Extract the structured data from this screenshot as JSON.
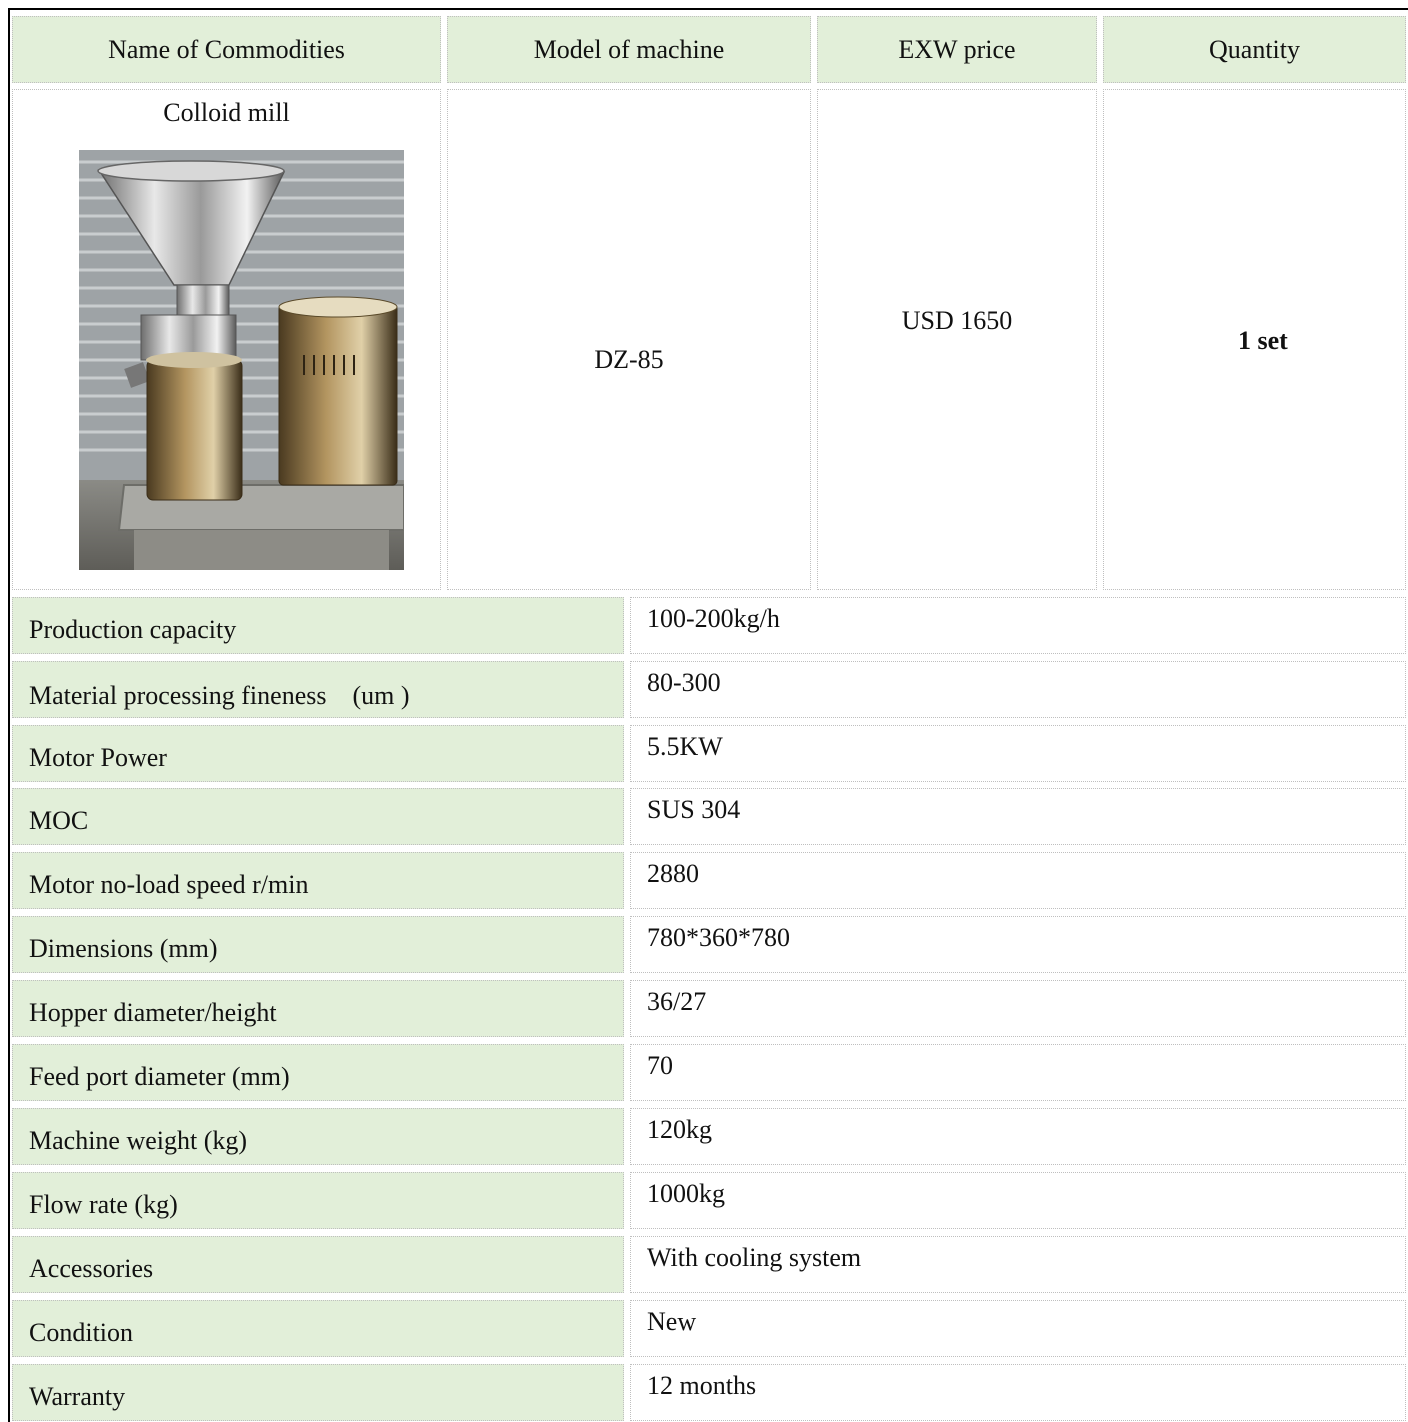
{
  "header": {
    "name_of_commodities": "Name of Commodities",
    "model_of_machine": "Model of machine",
    "exw_price": "EXW price",
    "quantity": "Quantity"
  },
  "product": {
    "name": "Colloid mill",
    "model": "DZ-85",
    "price": "USD 1650",
    "quantity": "1 set",
    "image_icon": "colloid-mill-photo"
  },
  "specs": [
    {
      "label": "Production capacity",
      "value": "100-200kg/h"
    },
    {
      "label": "Material processing fineness　(um )",
      "value": "80-300"
    },
    {
      "label": "Motor Power",
      "value": "5.5KW"
    },
    {
      "label": "MOC",
      "value": "SUS 304"
    },
    {
      "label": "Motor no-load speed r/min",
      "value": "2880"
    },
    {
      "label": "Dimensions (mm)",
      "value": "780*360*780"
    },
    {
      "label": "Hopper diameter/height",
      "value": "36/27"
    },
    {
      "label": "Feed port diameter (mm)",
      "value": "70"
    },
    {
      "label": "Machine weight (kg)",
      "value": "120kg"
    },
    {
      "label": "Flow rate (kg)",
      "value": "1000kg"
    },
    {
      "label": "Accessories",
      "value": "With cooling system"
    },
    {
      "label": "Condition",
      "value": "New"
    },
    {
      "label": "Warranty",
      "value": "12 months"
    }
  ],
  "colors": {
    "header_bg": "#e2efd9",
    "border": "#bfbfbf"
  }
}
